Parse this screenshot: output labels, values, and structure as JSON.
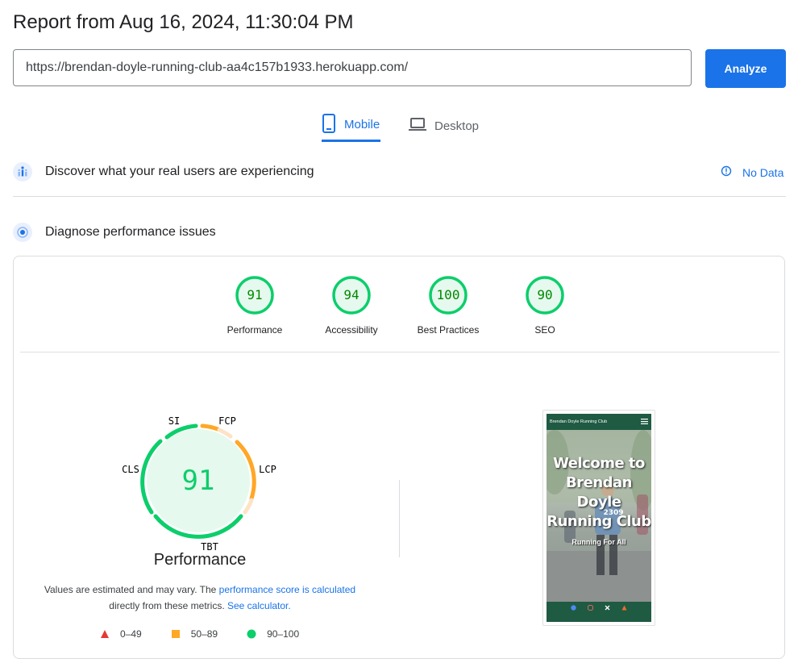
{
  "header": {
    "title": "Report from Aug 16, 2024, 11:30:04 PM",
    "url_value": "https://brendan-doyle-running-club-aa4c157b1933.herokuapp.com/",
    "analyze_label": "Analyze"
  },
  "tabs": [
    {
      "label": "Mobile",
      "icon": "smartphone-icon",
      "selected": true
    },
    {
      "label": "Desktop",
      "icon": "laptop-icon",
      "selected": false
    }
  ],
  "field_data": {
    "title": "Discover what your real users are experiencing",
    "status": "No Data",
    "icon": "users-icon"
  },
  "lab_data": {
    "title": "Diagnose performance issues",
    "icon": "target-icon"
  },
  "category_scores": [
    {
      "label": "Performance",
      "score": 91
    },
    {
      "label": "Accessibility",
      "score": 94
    },
    {
      "label": "Best Practices",
      "score": 100
    },
    {
      "label": "SEO",
      "score": 90
    }
  ],
  "performance_gauge": {
    "score": "91",
    "title": "Performance",
    "metric_labels": {
      "si": "SI",
      "fcp": "FCP",
      "lcp": "LCP",
      "tbt": "TBT",
      "cls": "CLS"
    },
    "note_prefix": "Values are estimated and may vary. The ",
    "note_link_1": "performance score is calculated",
    "note_middle": "directly from these metrics.",
    "note_link_2": "See calculator."
  },
  "legend": [
    {
      "range": "0–49",
      "shape": "triangle",
      "color": "#e53935"
    },
    {
      "range": "50–89",
      "shape": "square",
      "color": "#ffa726"
    },
    {
      "range": "90–100",
      "shape": "circle",
      "color": "#0cce6b"
    }
  ],
  "page_preview": {
    "nav_title": "Brendan Doyle Running Club",
    "hero_title": "Welcome to Brendan Doyle Running Club",
    "hero_subtitle": "Running For All",
    "bib_number": "2309"
  },
  "colors": {
    "accent": "#1a73e8",
    "pass": "#0cce6b",
    "average": "#ffa726",
    "fail": "#e53935",
    "pass_text": "#008800"
  }
}
